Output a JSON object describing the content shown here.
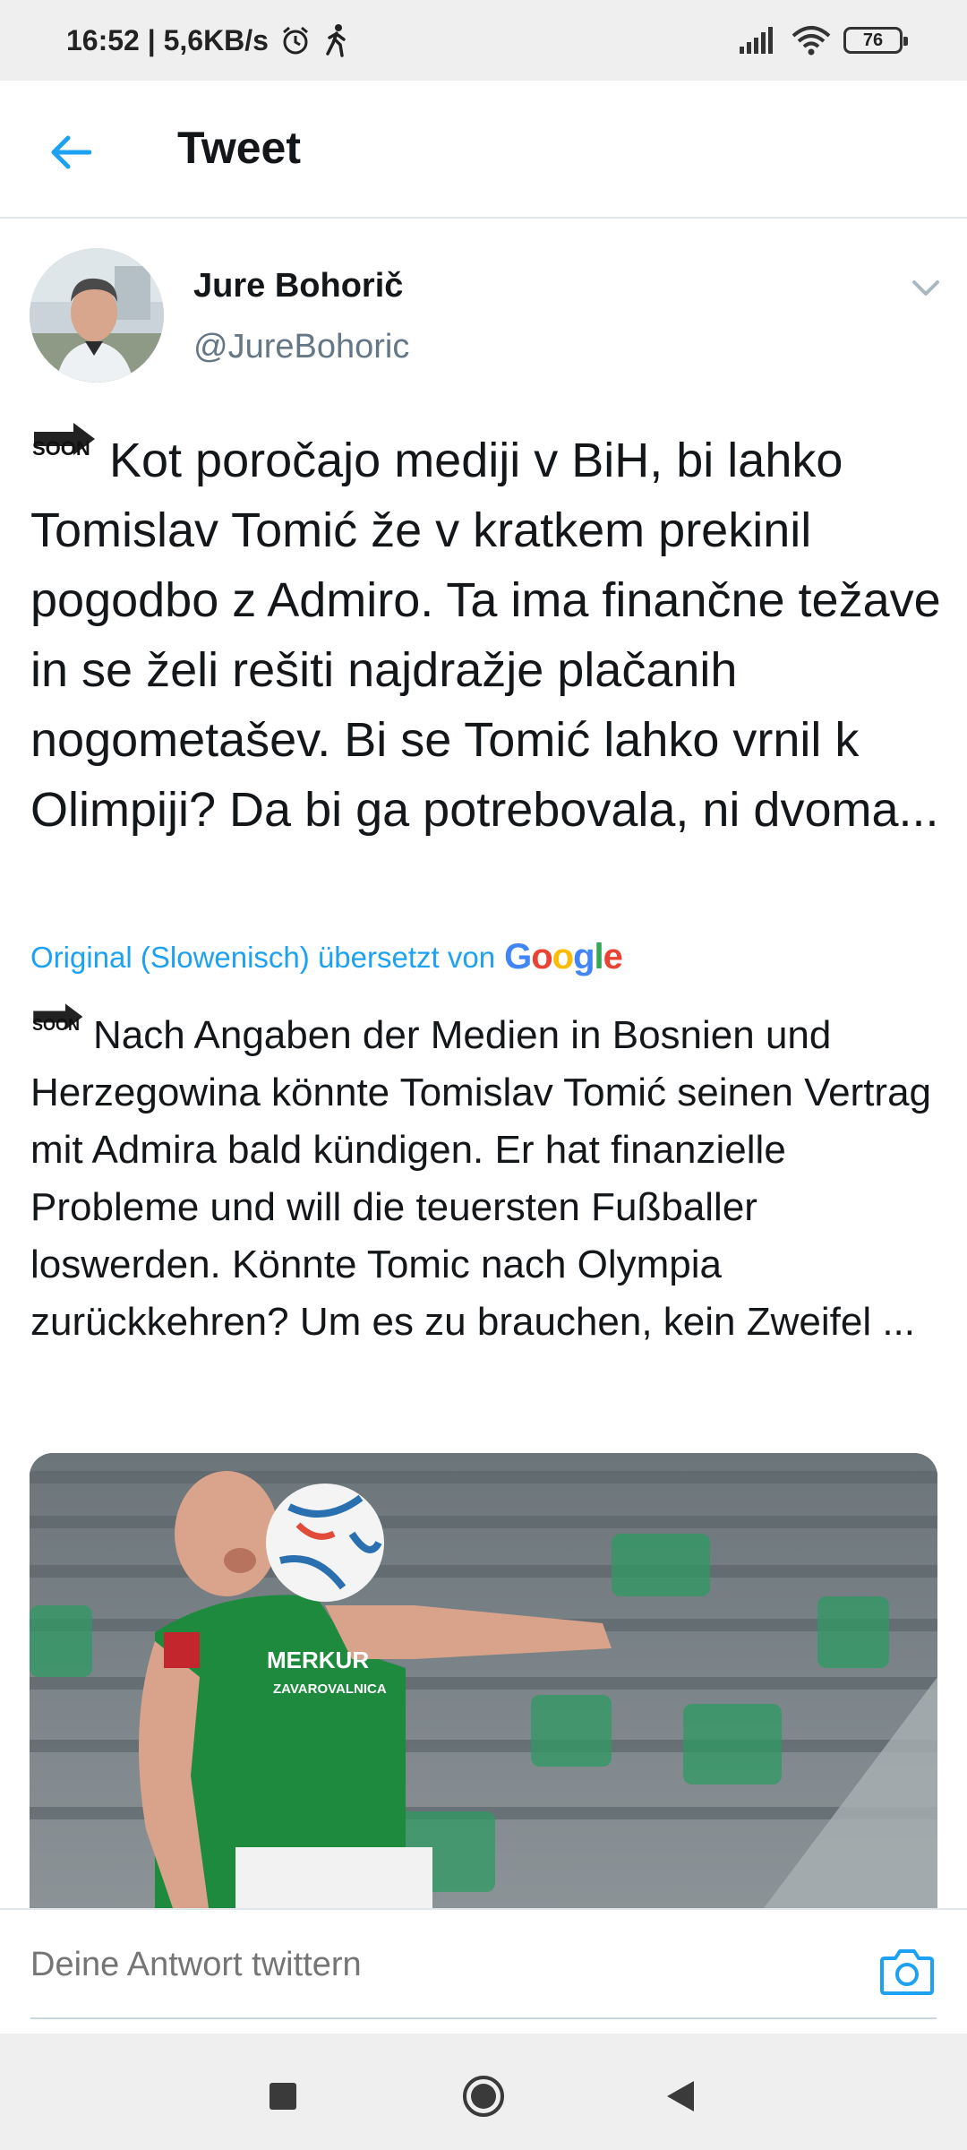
{
  "status_bar": {
    "time_speed": "16:52 | 5,6KB/s",
    "battery": "76"
  },
  "header": {
    "title": "Tweet",
    "back_icon": "arrow-left-icon"
  },
  "tweet": {
    "author_name": "Jure Bohorič",
    "author_handle": "@JureBohoric",
    "soon_emoji_label": "SOON",
    "text": "Kot poročajo mediji v BiH, bi lahko Tomislav Tomić že v kratkem prekinil pogodbo z Admiro. Ta ima finančne težave in se želi rešiti najdražje plačanih nogometašev. Bi se Tomić lahko vrnil k Olimpiji? Da bi ga potrebovala, ni dvoma...",
    "translation_label": "Original (Slowenisch) übersetzt von",
    "translation_brand": "Google",
    "translated_text": "Nach Angaben der Medien in Bosnien und Herzegowina könnte Tomislav Tomić seinen Vertrag mit Admira bald kündigen. Er hat finanzielle Probleme und will die teuersten Fußballer loswerden. Könnte Tomic nach Olympia zurückkehren? Um es zu brauchen, kein Zweifel ...",
    "media_sponsor_text": "MERKUR ZAVAROVALNICA"
  },
  "reply": {
    "placeholder": "Deine Antwort twittern"
  },
  "colors": {
    "accent": "#1da1f2",
    "text": "#14171a",
    "secondary_text": "#657786"
  }
}
